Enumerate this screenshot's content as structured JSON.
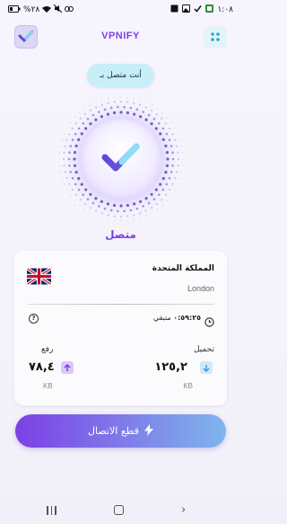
{
  "status_bar": {
    "time": "١:٠٨",
    "battery": "%٢٨"
  },
  "header": {
    "title": "VPNIFY"
  },
  "status_pill": {
    "text": "أنت متصل بـ"
  },
  "connection": {
    "state_label": "متصل"
  },
  "server": {
    "country": "المملكة المتحدة",
    "city": "London"
  },
  "timer": {
    "value": "٠:٥٩:٢٥",
    "label": "متبقي"
  },
  "traffic": {
    "download_label": "تحميل",
    "download_value": "١٢٥,٢",
    "download_unit": "KB",
    "upload_label": "رفع",
    "upload_value": "٧٨,٤",
    "upload_unit": "KB"
  },
  "actions": {
    "disconnect_label": "قطع الاتصال"
  },
  "colors": {
    "accent": "#7b3fe4",
    "button_gradient_start": "#7d3fe6",
    "button_gradient_end": "#7fb6ec"
  },
  "icons": [
    "check-logo-icon",
    "grid-menu-icon",
    "flag-uk-icon",
    "help-icon",
    "clock-icon",
    "upload-arrow-icon",
    "download-arrow-icon",
    "bolt-icon"
  ]
}
